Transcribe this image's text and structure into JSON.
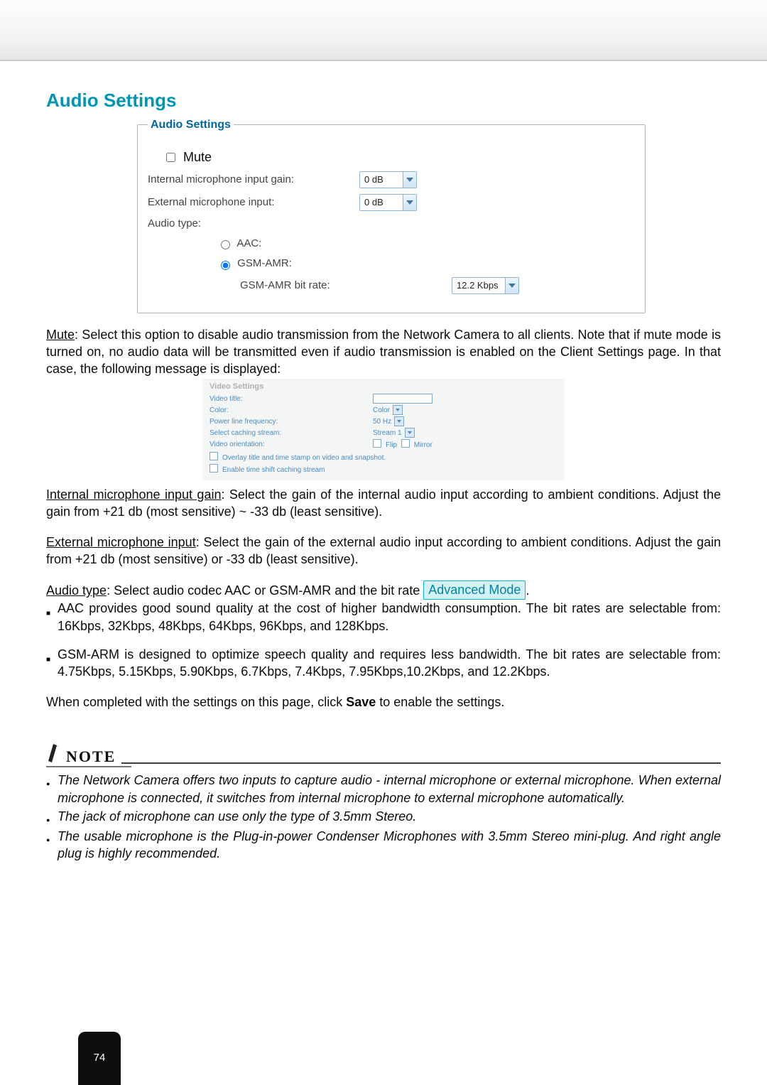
{
  "page_number": "74",
  "heading": "Audio Settings",
  "panel": {
    "legend": "Audio Settings",
    "mute_label": "Mute",
    "internal_mic_label": "Internal microphone input gain:",
    "internal_mic_value": "0 dB",
    "external_mic_label": "External microphone input:",
    "external_mic_value": "0 dB",
    "audio_type_label": "Audio type:",
    "aac_label": "AAC:",
    "gsmamr_label": "GSM-AMR:",
    "gsmamr_bitrate_label": "GSM-AMR bit rate:",
    "gsmamr_bitrate_value": "12.2 Kbps"
  },
  "body": {
    "mute_term": "Mute",
    "mute_text": ": Select this option to disable audio transmission from the Network Camera to all clients. Note that if mute mode is turned on, no audio data will be transmitted even if audio transmission is enabled on the Client Settings page. In that case, the following message is displayed:",
    "internal_term": "Internal microphone input gain",
    "internal_text": ": Select the gain of the internal audio input according to ambient conditions. Adjust the gain from +21 db (most sensitive) ~ -33 db (least sensitive).",
    "external_term": "External microphone input",
    "external_text": ": Select the gain of the external audio input according to ambient conditions. Adjust the gain from +21 db (most sensitive) or -33 db (least sensitive).",
    "audiotype_term": "Audio type",
    "audiotype_intro": ": Select audio codec AAC or GSM-AMR and the bit rate ",
    "adv_mode_badge": "Advanced Mode",
    "period": ".",
    "aac_bullet": "AAC provides good sound quality at the cost of higher bandwidth consumption. The bit rates are selectable from: 16Kbps, 32Kbps, 48Kbps, 64Kbps, 96Kbps, and 128Kbps.",
    "gsm_bullet": "GSM-ARM is designed to optimize speech quality and requires less bandwidth. The bit rates are selectable from: 4.75Kbps, 5.15Kbps, 5.90Kbps, 6.7Kbps, 7.4Kbps, 7.95Kbps,10.2Kbps, and 12.2Kbps.",
    "save_pre": "When completed with the settings on this page, click ",
    "save_word": "Save",
    "save_post": " to enable the settings."
  },
  "video_snippet": {
    "title": "Video Settings",
    "rows": {
      "title_label": "Video title:",
      "color_label": "Color:",
      "color_value": "Color",
      "freq_label": "Power line frequency:",
      "freq_value": "50 Hz",
      "caching_label": "Select caching stream:",
      "caching_value": "Stream 1",
      "orient_label": "Video orientation:",
      "flip_label": "Flip",
      "mirror_label": "Mirror",
      "overlay_label": "Overlay title and time stamp on video and snapshot.",
      "enable_label": "Enable time shift caching stream"
    }
  },
  "note": {
    "word": "NOTE",
    "items": [
      "The Network Camera offers two inputs to capture audio - internal microphone or external microphone. When external microphone is connected, it switches from internal microphone to external microphone automatically.",
      "The jack of microphone can use only the type of 3.5mm Stereo.",
      "The usable microphone is the Plug-in-power Condenser Microphones with 3.5mm Stereo mini-plug. And right angle plug is highly recommended."
    ]
  }
}
